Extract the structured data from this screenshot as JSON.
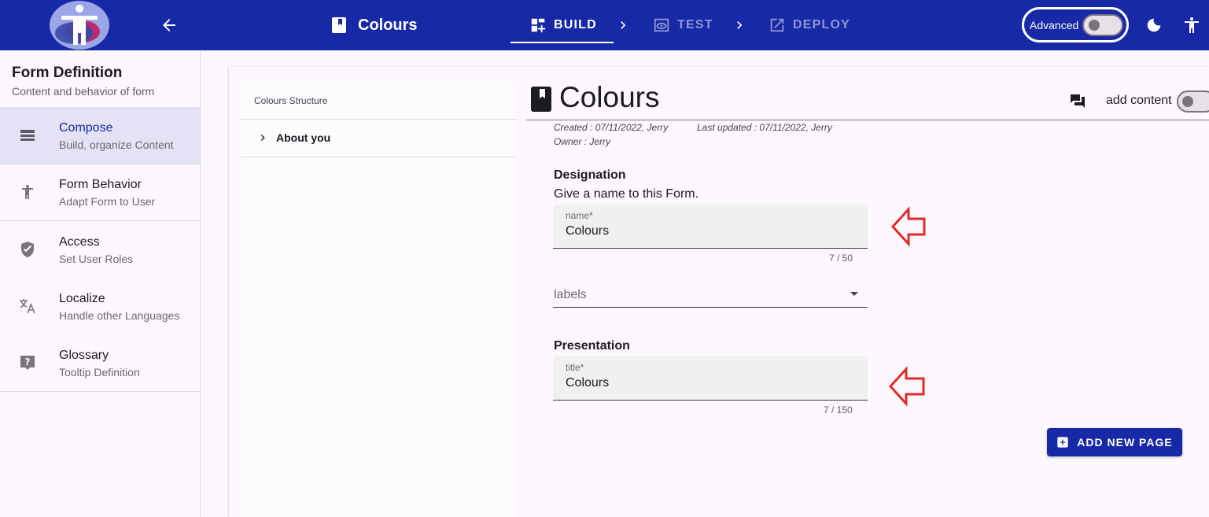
{
  "topbar": {
    "form_name": "Colours",
    "steps": [
      {
        "label": "BUILD",
        "active": true,
        "icon": "dashboard-add-icon"
      },
      {
        "label": "TEST",
        "active": false,
        "icon": "preview-eye-icon"
      },
      {
        "label": "DEPLOY",
        "active": false,
        "icon": "open-in-new-icon"
      }
    ],
    "advanced_label": "Advanced",
    "colors": {
      "bar": "#1729a6",
      "inactive_step": "#8f96cf"
    }
  },
  "sidebar": {
    "title": "Form Definition",
    "subtitle": "Content and behavior of form",
    "items": [
      {
        "label": "Compose",
        "sub": "Build, organize Content",
        "icon": "compose-list-icon",
        "active": true
      },
      {
        "label": "Form Behavior",
        "sub": "Adapt Form to User",
        "icon": "accessibility-icon",
        "active": false
      },
      {
        "label": "Access",
        "sub": "Set User Roles",
        "icon": "shield-check-icon",
        "active": false
      },
      {
        "label": "Localize",
        "sub": "Handle other Languages",
        "icon": "translate-icon",
        "active": false
      },
      {
        "label": "Glossary",
        "sub": "Tooltip Definition",
        "icon": "help-box-icon",
        "active": false
      }
    ]
  },
  "structure": {
    "heading": "Colours Structure",
    "items": [
      {
        "label": "About you"
      }
    ]
  },
  "detail": {
    "title": "Colours",
    "add_content_label": "add content",
    "meta": {
      "created": "Created : 07/11/2022, Jerry",
      "updated": "Last updated : 07/11/2022, Jerry",
      "owner": "Owner : Jerry"
    },
    "designation": {
      "heading": "Designation",
      "description": "Give a name to this Form.",
      "name_label": "name*",
      "name_value": "Colours",
      "name_counter": "7 / 50",
      "labels_placeholder": "labels"
    },
    "presentation": {
      "heading": "Presentation",
      "title_label": "title*",
      "title_value": "Colours",
      "title_counter": "7 / 150"
    },
    "add_page_label": "ADD NEW PAGE",
    "annotation_color": "#e02a2a"
  }
}
